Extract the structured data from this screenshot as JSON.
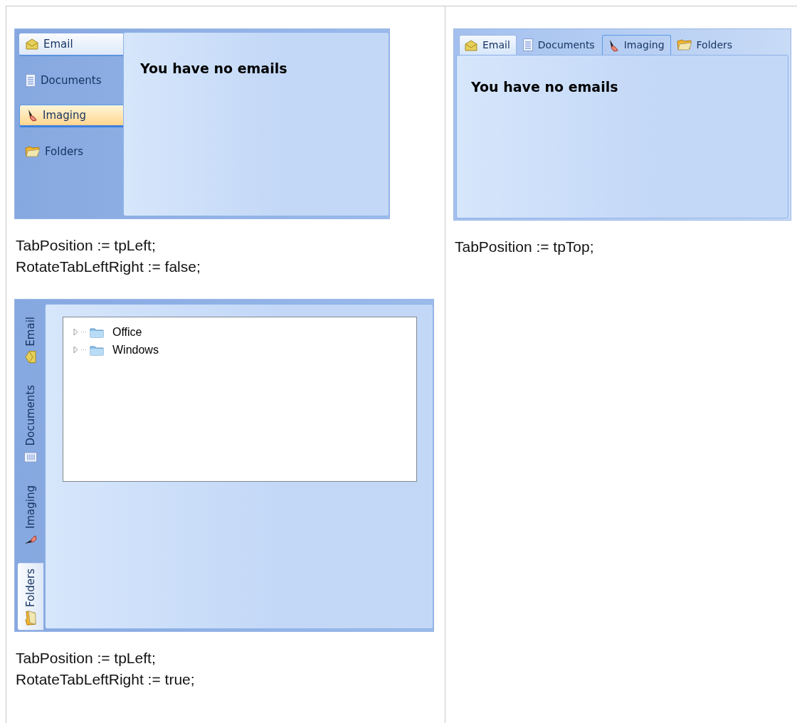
{
  "columns": [
    {
      "examples": [
        {
          "kind": "left",
          "tabs": [
            {
              "label": "Email",
              "selected": true,
              "hovered": false
            },
            {
              "label": "Documents",
              "selected": false,
              "hovered": false
            },
            {
              "label": "Imaging",
              "selected": false,
              "hovered": true
            },
            {
              "label": "Folders",
              "selected": false,
              "hovered": false
            }
          ],
          "content": {
            "kind": "message",
            "text": "You have no emails"
          },
          "caption": [
            "TabPosition := tpLeft;",
            "RotateTabLeftRight := false;"
          ]
        },
        {
          "kind": "rotated",
          "tabs": [
            {
              "label": "Email",
              "selected": false,
              "hovered": false
            },
            {
              "label": "Documents",
              "selected": false,
              "hovered": false
            },
            {
              "label": "Imaging",
              "selected": false,
              "hovered": false
            },
            {
              "label": "Folders",
              "selected": true,
              "hovered": false
            }
          ],
          "content": {
            "kind": "tree",
            "items": [
              {
                "label": "Office",
                "expanded": false
              },
              {
                "label": "Windows",
                "expanded": false
              }
            ]
          },
          "caption": [
            "TabPosition := tpLeft;",
            "RotateTabLeftRight := true;"
          ]
        }
      ]
    },
    {
      "examples": [
        {
          "kind": "top",
          "tabs": [
            {
              "label": "Email",
              "selected": true,
              "hovered": false
            },
            {
              "label": "Documents",
              "selected": false,
              "hovered": false
            },
            {
              "label": "Imaging",
              "selected": false,
              "hovered": true
            },
            {
              "label": "Folders",
              "selected": false,
              "hovered": false
            }
          ],
          "content": {
            "kind": "message",
            "text": "You have no emails"
          },
          "caption": [
            "TabPosition := tpTop;"
          ]
        }
      ]
    }
  ]
}
